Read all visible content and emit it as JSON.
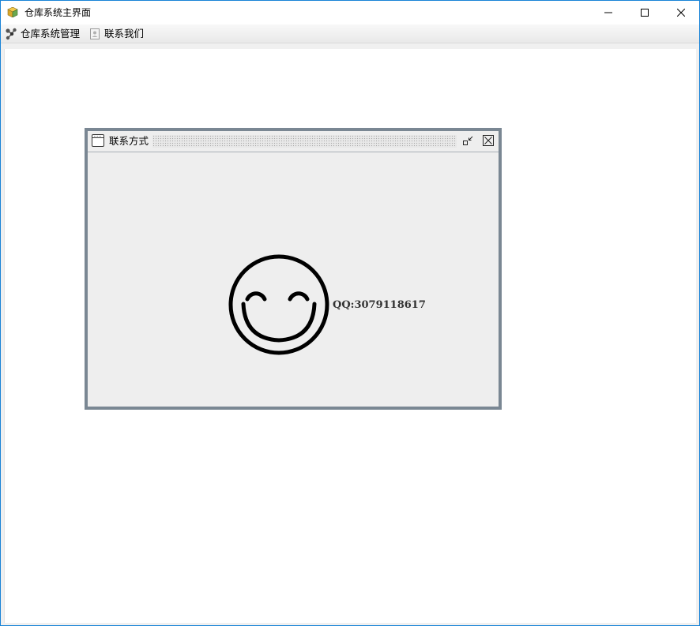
{
  "window": {
    "title": "仓库系统主界面",
    "icon": "package-icon",
    "buttons": {
      "minimize": "minimize-icon",
      "maximize": "maximize-icon",
      "close": "close-icon"
    },
    "border_color": "#1883d7"
  },
  "menubar": {
    "items": [
      {
        "label": "仓库系统管理",
        "icon": "network-nodes-icon"
      },
      {
        "label": "联系我们",
        "icon": "contact-card-icon"
      }
    ]
  },
  "internal_frame": {
    "title": "联系方式",
    "icon": "window-icon",
    "buttons": {
      "restore": "restore-icon",
      "close": "close-icon"
    },
    "frame_color": "#7a8793",
    "content": {
      "image": "smiley-face-icon",
      "qq_label": "QQ:3079118617"
    }
  }
}
